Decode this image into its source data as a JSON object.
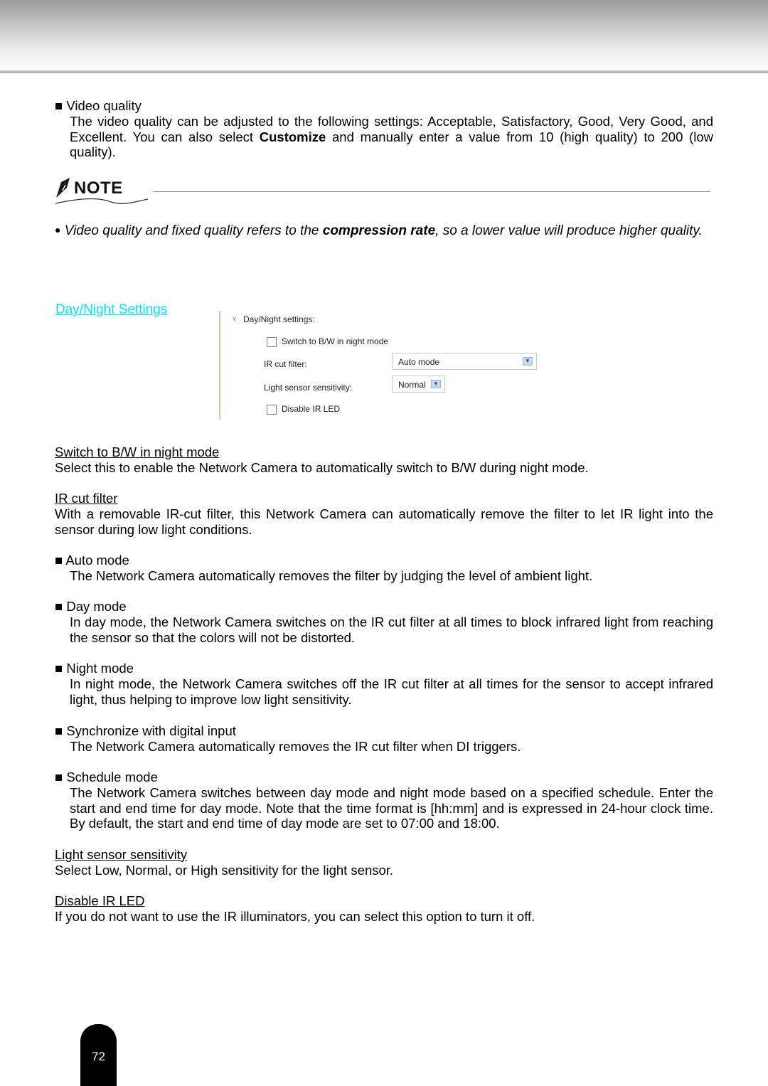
{
  "video_quality": {
    "title": "Video quality",
    "body_1": "The video quality can be adjusted to the following settings: Acceptable, Satisfactory, Good, Very Good, and Excellent. You can also select ",
    "body_bold": "Customize",
    "body_2": " and manually enter a value from 10 (high quality) to 200 (low quality)."
  },
  "note": {
    "label": "NOTE",
    "text_1": "Video quality and fixed quality refers to the ",
    "text_bold": "compression rate",
    "text_2": ", so a lower value will produce higher quality."
  },
  "day_night_link": "Day/Night Settings",
  "ui": {
    "section_title": "Day/Night settings:",
    "switch_bw_label": "Switch to B/W in night mode",
    "switch_bw_checked": false,
    "ir_cut_label": "IR cut filter:",
    "ir_cut_value": "Auto mode",
    "light_sensor_label": "Light sensor sensitivity:",
    "light_sensor_value": "Normal",
    "disable_ir_label": "Disable IR LED",
    "disable_ir_checked": false
  },
  "sections": {
    "switch_bw": {
      "title": "Switch to B/W in night mode",
      "body": "Select this to enable the Network Camera to automatically switch to B/W during night mode."
    },
    "ir_cut": {
      "title": "IR cut filter",
      "body": "With a removable IR-cut filter, this Network Camera can automatically remove the filter to let IR light into the sensor during low light conditions."
    },
    "modes": [
      {
        "title": "Auto mode",
        "body": "The Network Camera automatically removes the filter by judging the level of ambient light."
      },
      {
        "title": "Day mode",
        "body": "In day mode, the Network Camera switches on the IR cut filter at all times to block infrared light from reaching the sensor so that the colors will not be distorted."
      },
      {
        "title": "Night mode",
        "body": "In night mode, the Network Camera switches off the IR cut filter at all times for the sensor to accept infrared light, thus helping to improve low light sensitivity."
      },
      {
        "title": "Synchronize with digital input",
        "body": "The Network Camera automatically removes the IR cut filter when DI triggers."
      },
      {
        "title": "Schedule mode",
        "body": "The Network Camera switches between day mode and night mode based on a specified schedule. Enter the start and end time for day mode. Note that the time format is [hh:mm] and is expressed in 24-hour clock time. By default, the start and end time of day mode are set to 07:00 and 18:00."
      }
    ],
    "light_sensor": {
      "title": "Light sensor sensitivity",
      "body": "Select Low, Normal, or High sensitivity for the light sensor."
    },
    "disable_ir": {
      "title": "Disable IR LED",
      "body": "If you do not want to use the IR illuminators, you can select this option to turn it off."
    }
  },
  "bullet_glyph": "■",
  "note_bullet_glyph": "●",
  "page_number": "72"
}
